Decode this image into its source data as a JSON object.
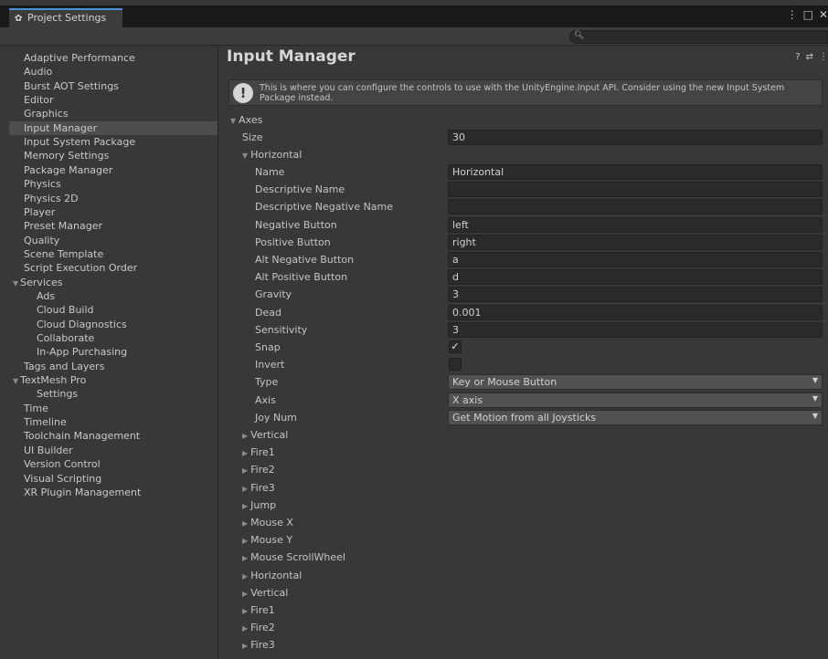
{
  "window": {
    "tab_title": "Project Settings",
    "tab_icon": "gear-icon",
    "controls": [
      "⋮",
      "□",
      "✕"
    ]
  },
  "search": {
    "placeholder": ""
  },
  "sidebar": {
    "items": [
      {
        "label": "Adaptive Performance",
        "indent": 0
      },
      {
        "label": "Audio",
        "indent": 0
      },
      {
        "label": "Burst AOT Settings",
        "indent": 0
      },
      {
        "label": "Editor",
        "indent": 0
      },
      {
        "label": "Graphics",
        "indent": 0
      },
      {
        "label": "Input Manager",
        "indent": 0,
        "selected": true
      },
      {
        "label": "Input System Package",
        "indent": 0
      },
      {
        "label": "Memory Settings",
        "indent": 0
      },
      {
        "label": "Package Manager",
        "indent": 0
      },
      {
        "label": "Physics",
        "indent": 0
      },
      {
        "label": "Physics 2D",
        "indent": 0
      },
      {
        "label": "Player",
        "indent": 0
      },
      {
        "label": "Preset Manager",
        "indent": 0
      },
      {
        "label": "Quality",
        "indent": 0
      },
      {
        "label": "Scene Template",
        "indent": 0
      },
      {
        "label": "Script Execution Order",
        "indent": 0
      },
      {
        "label": "Services",
        "indent": 0,
        "expanded": true
      },
      {
        "label": "Ads",
        "indent": 1
      },
      {
        "label": "Cloud Build",
        "indent": 1
      },
      {
        "label": "Cloud Diagnostics",
        "indent": 1
      },
      {
        "label": "Collaborate",
        "indent": 1
      },
      {
        "label": "In-App Purchasing",
        "indent": 1
      },
      {
        "label": "Tags and Layers",
        "indent": 0
      },
      {
        "label": "TextMesh Pro",
        "indent": 0,
        "expanded": true
      },
      {
        "label": "Settings",
        "indent": 1
      },
      {
        "label": "Time",
        "indent": 0
      },
      {
        "label": "Timeline",
        "indent": 0
      },
      {
        "label": "Toolchain Management",
        "indent": 0
      },
      {
        "label": "UI Builder",
        "indent": 0
      },
      {
        "label": "Version Control",
        "indent": 0
      },
      {
        "label": "Visual Scripting",
        "indent": 0
      },
      {
        "label": "XR Plugin Management",
        "indent": 0
      }
    ]
  },
  "main": {
    "title": "Input Manager",
    "help_icons": [
      "?",
      "⇄",
      "⋮"
    ],
    "info": "This is where you can configure the controls to use with the UnityEngine.Input API. Consider using the new Input System Package instead.",
    "axes_label": "Axes",
    "size_label": "Size",
    "size_value": "30",
    "horizontal_label": "Horizontal",
    "fields": [
      {
        "label": "Name",
        "value": "Horizontal",
        "kind": "text"
      },
      {
        "label": "Descriptive Name",
        "value": "",
        "kind": "text"
      },
      {
        "label": "Descriptive Negative Name",
        "value": "",
        "kind": "text"
      },
      {
        "label": "Negative Button",
        "value": "left",
        "kind": "text"
      },
      {
        "label": "Positive Button",
        "value": "right",
        "kind": "text"
      },
      {
        "label": "Alt Negative Button",
        "value": "a",
        "kind": "text"
      },
      {
        "label": "Alt Positive Button",
        "value": "d",
        "kind": "text"
      },
      {
        "label": "Gravity",
        "value": "3",
        "kind": "text"
      },
      {
        "label": "Dead",
        "value": "0.001",
        "kind": "text"
      },
      {
        "label": "Sensitivity",
        "value": "3",
        "kind": "text"
      },
      {
        "label": "Snap",
        "value": "✓",
        "kind": "checkbox",
        "checked": true
      },
      {
        "label": "Invert",
        "value": "",
        "kind": "checkbox",
        "checked": false
      },
      {
        "label": "Type",
        "value": "Key or Mouse Button",
        "kind": "dropdown"
      },
      {
        "label": "Axis",
        "value": "X axis",
        "kind": "dropdown"
      },
      {
        "label": "Joy Num",
        "value": "Get Motion from all Joysticks",
        "kind": "dropdown"
      }
    ],
    "collapsed_axes": [
      "Vertical",
      "Fire1",
      "Fire2",
      "Fire3",
      "Jump",
      "Mouse X",
      "Mouse Y",
      "Mouse ScrollWheel",
      "Horizontal",
      "Vertical",
      "Fire1",
      "Fire2",
      "Fire3"
    ]
  }
}
